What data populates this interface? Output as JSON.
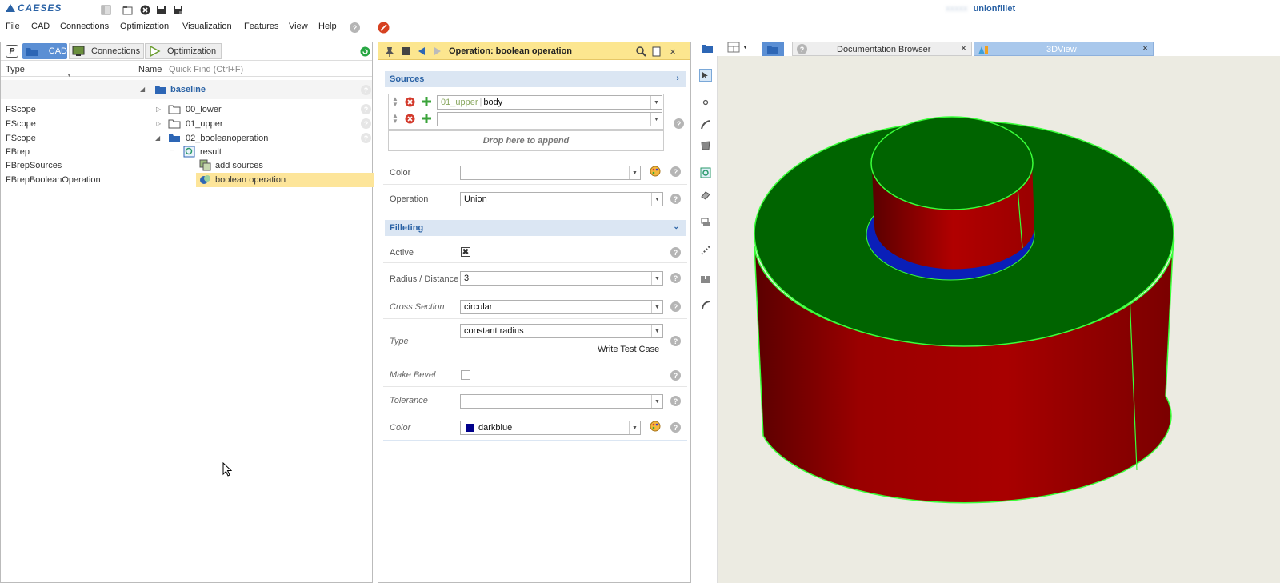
{
  "app": {
    "logo": "CAESES",
    "doc_title_blur": "xxxxx",
    "doc_title": "unionfillet"
  },
  "menu": [
    "File",
    "CAD",
    "Connections",
    "Optimization",
    "Visualization",
    "Features",
    "View",
    "Help"
  ],
  "left_tabs": {
    "p": "P",
    "cad": "CAD",
    "connections": "Connections",
    "optimization": "Optimization"
  },
  "tree_header": {
    "type": "Type",
    "name": "Name",
    "find_placeholder": "Quick Find (Ctrl+F)"
  },
  "tree": {
    "root": "baseline",
    "rows": [
      {
        "type": "FScope",
        "name": "00_lower"
      },
      {
        "type": "FScope",
        "name": "01_upper"
      },
      {
        "type": "FScope",
        "name": "02_booleanoperation"
      },
      {
        "type": "FBrep",
        "name": "result"
      },
      {
        "type": "FBrepSources",
        "name": "add sources"
      },
      {
        "type": "FBrepBooleanOperation",
        "name": "boolean operation"
      }
    ]
  },
  "op_panel": {
    "title": "Operation: boolean operation",
    "sources_header": "Sources",
    "source1_prefix": "01_upper",
    "source1_value": "body",
    "source2_value": "",
    "drop_hint": "Drop here to append",
    "color_label": "Color",
    "color_value": "",
    "operation_label": "Operation",
    "operation_value": "Union",
    "filleting_header": "Filleting",
    "active_label": "Active",
    "radius_label": "Radius / Distance",
    "radius_value": "3",
    "cross_label": "Cross Section",
    "cross_value": "circular",
    "type_label": "Type",
    "type_value": "constant radius",
    "write_test": "Write Test Case",
    "bevel_label": "Make Bevel",
    "tolerance_label": "Tolerance",
    "tolerance_value": "",
    "color2_label": "Color",
    "color2_value": "darkblue"
  },
  "view_tabs": {
    "doc": "Documentation Browser",
    "view3d": "3DView"
  },
  "colors": {
    "accent": "#2a62a5",
    "selected": "#fde59a",
    "panel_header": "#fce68f",
    "solid_red": "#b30000",
    "solid_green": "#006400",
    "fillet_blue": "#0a1fb8"
  }
}
